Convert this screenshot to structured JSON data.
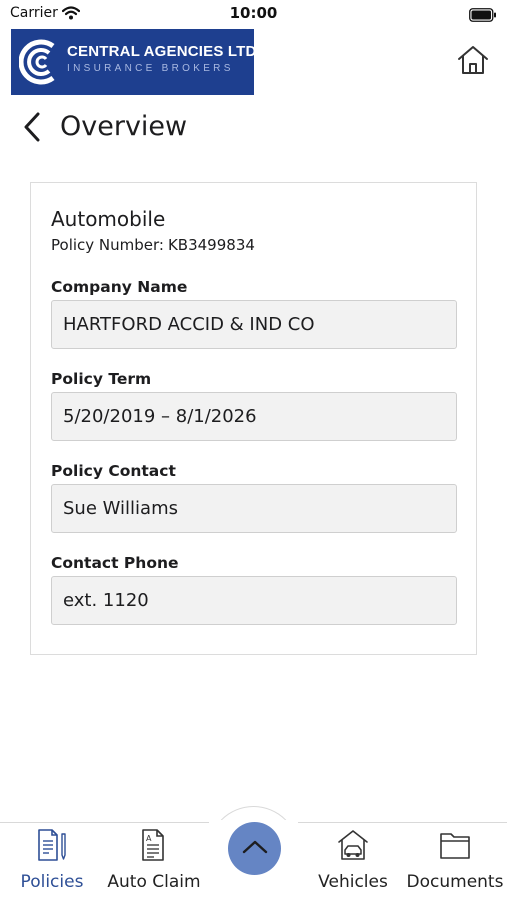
{
  "status_bar": {
    "carrier": "Carrier",
    "time": "10:00"
  },
  "header": {
    "logo_name": "CENTRAL AGENCIES LTD.",
    "logo_subtitle": "INSURANCE BROKERS",
    "brand_color": "#1e3f8f"
  },
  "page": {
    "title": "Overview"
  },
  "policy": {
    "type": "Automobile",
    "number_label": "Policy Number:",
    "number_value": "KB3499834",
    "fields": [
      {
        "label": "Company Name",
        "value": "HARTFORD ACCID & IND CO"
      },
      {
        "label": "Policy Term",
        "value": "5/20/2019 – 8/1/2026"
      },
      {
        "label": "Policy Contact",
        "value": "Sue Williams"
      },
      {
        "label": "Contact Phone",
        "value": "ext. 1120"
      }
    ]
  },
  "bottom_nav": {
    "items": [
      {
        "label": "Policies",
        "icon": "policies-document-icon",
        "active": true
      },
      {
        "label": "Auto Claim",
        "icon": "auto-claim-form-icon",
        "active": false
      },
      {
        "label": "Vehicles",
        "icon": "vehicle-garage-icon",
        "active": false
      },
      {
        "label": "Documents",
        "icon": "folder-icon",
        "active": false
      }
    ],
    "center_button_icon": "chevron-up-icon",
    "active_color": "#2e4f96",
    "fab_color": "#6585c4"
  }
}
